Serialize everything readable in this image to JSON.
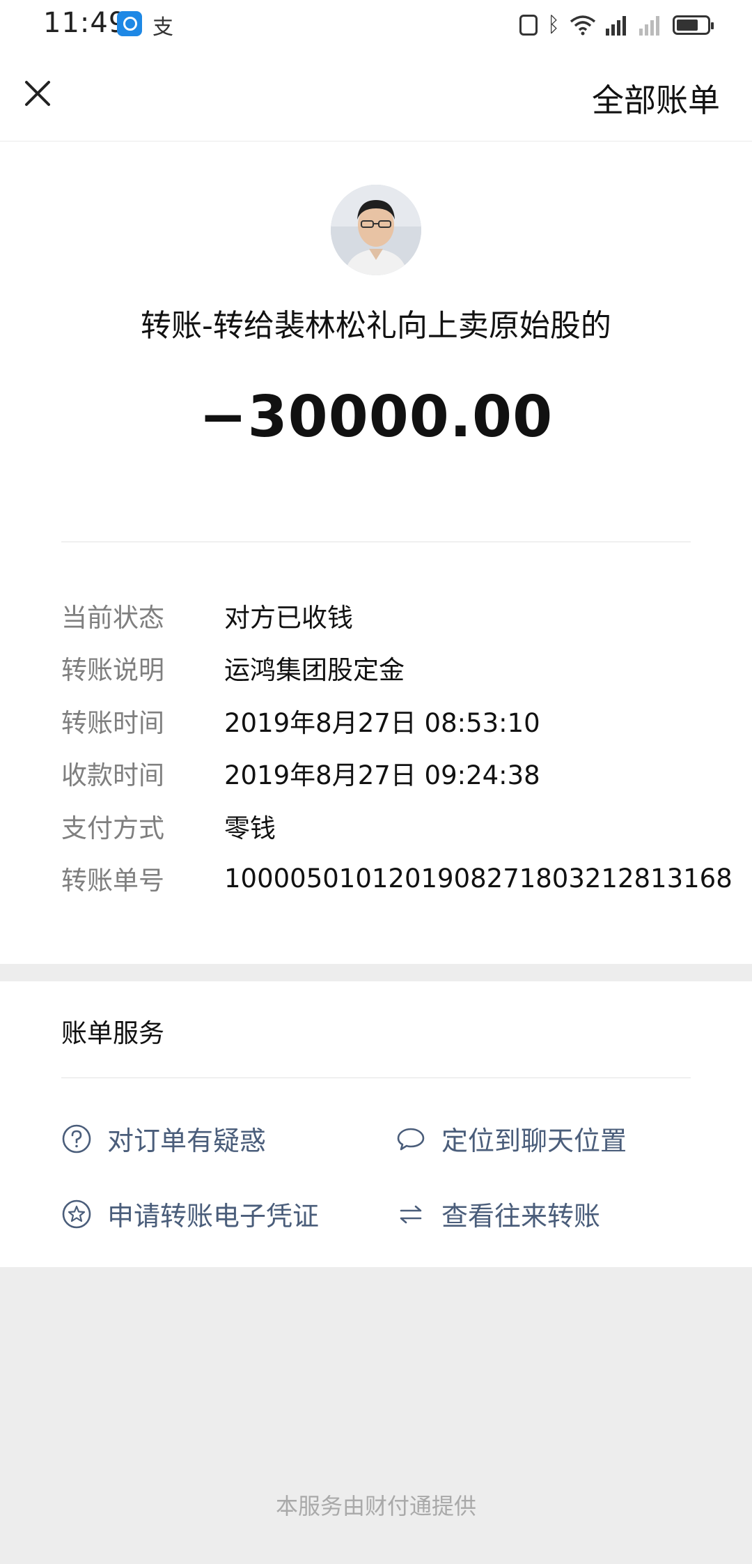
{
  "status_bar": {
    "time": "11:49",
    "app_icons": [
      "search-app-icon",
      "pay-app-icon"
    ],
    "pay_glyph": "支",
    "right_icons": [
      "nfc-icon",
      "bluetooth-icon",
      "wifi-icon",
      "signal-icon",
      "signal-weak-icon",
      "battery-icon"
    ],
    "bluetooth_glyph": "ᛒ"
  },
  "header": {
    "close_icon": "close-icon",
    "all_bills_label": "全部账单"
  },
  "transfer": {
    "avatar": "avatar-photo",
    "title": "转账-转给裴林松礼向上卖原始股的",
    "amount": "−30000.00"
  },
  "details": [
    {
      "label": "当前状态",
      "value": "对方已收钱"
    },
    {
      "label": "转账说明",
      "value": "运鸿集团股定金"
    },
    {
      "label": "转账时间",
      "value": "2019年8月27日 08:53:10"
    },
    {
      "label": "收款时间",
      "value": "2019年8月27日 09:24:38"
    },
    {
      "label": "支付方式",
      "value": "零钱"
    },
    {
      "label": "转账单号",
      "value": "1000050101201908271803212813168"
    }
  ],
  "services": {
    "title": "账单服务",
    "items": [
      {
        "icon": "question-circle-icon",
        "label": "对订单有疑惑"
      },
      {
        "icon": "chat-bubble-icon",
        "label": "定位到聊天位置"
      },
      {
        "icon": "star-circle-icon",
        "label": "申请转账电子凭证"
      },
      {
        "icon": "swap-arrows-icon",
        "label": "查看往来转账"
      }
    ]
  },
  "footer": {
    "note": "本服务由财付通提供"
  },
  "colors": {
    "page_background": "#ededed",
    "card_background": "#ffffff",
    "label_gray": "#7f7f7f",
    "link_blue_gray": "#4a5d7a",
    "footer_gray": "#a9a9a9"
  }
}
